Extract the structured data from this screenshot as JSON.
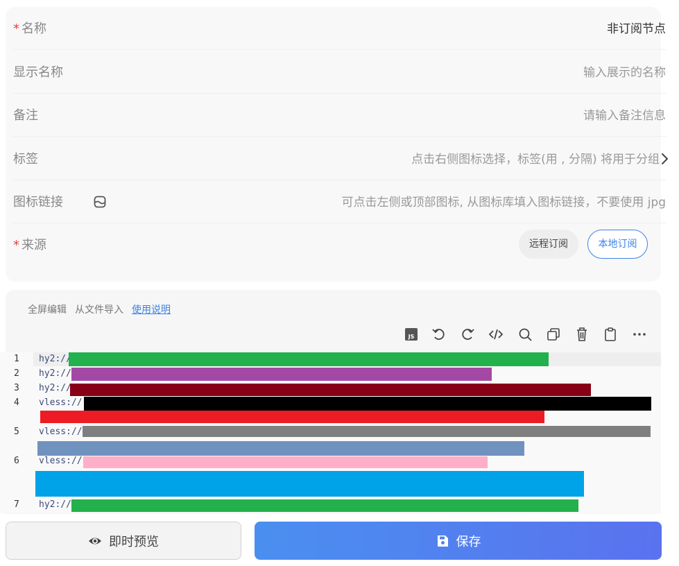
{
  "form": {
    "name": {
      "label": "名称",
      "required_mark": "*",
      "value": "非订阅节点"
    },
    "display_name": {
      "label": "显示名称",
      "placeholder": "输入展示的名称"
    },
    "remark": {
      "label": "备注",
      "placeholder": "请输入备注信息"
    },
    "tags": {
      "label": "标签",
      "placeholder": "点击右侧图标选择，标签(用 , 分隔) 将用于分组"
    },
    "icon_link": {
      "label": "图标链接",
      "placeholder": "可点击左侧或顶部图标, 从图标库填入图标链接，不要使用 jpg"
    },
    "source": {
      "label": "来源",
      "required_mark": "*",
      "options": [
        "远程订阅",
        "本地订阅"
      ],
      "selected": "本地订阅"
    }
  },
  "editor": {
    "links": {
      "fullscreen": "全屏编辑",
      "import_file": "从文件导入",
      "help": "使用说明"
    },
    "toolbar_icons": [
      "js-icon",
      "undo-icon",
      "redo-icon",
      "code-icon",
      "search-icon",
      "copy-icon",
      "trash-icon",
      "clipboard-icon",
      "more-icon"
    ],
    "lines": [
      {
        "number": "1",
        "prefix": "hy2://"
      },
      {
        "number": "2",
        "prefix": "hy2://"
      },
      {
        "number": "3",
        "prefix": "hy2://"
      },
      {
        "number": "4",
        "prefix": "vless://"
      },
      {
        "number": "5",
        "prefix": "vless://"
      },
      {
        "number": "6",
        "prefix": "vless://"
      },
      {
        "number": "7",
        "prefix": "hy2://"
      }
    ],
    "redaction_colors": [
      "#22b14c",
      "#a349a4",
      "#880015",
      "#000000",
      "#ed1c24",
      "#7f7f7f",
      "#7092be",
      "#ffaec9",
      "#00a2e8"
    ]
  },
  "actions": {
    "preview": "即时预览",
    "save": "保存"
  },
  "colors": {
    "accent": "#3b82e8",
    "required": "#e0443a",
    "save_start": "#4a8ff0",
    "save_end": "#5a72ee"
  }
}
